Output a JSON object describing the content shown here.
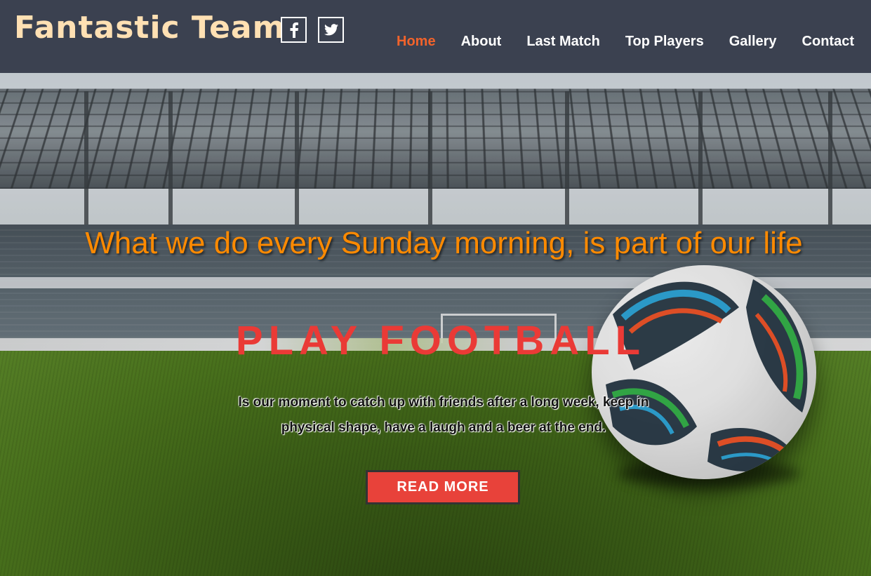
{
  "header": {
    "brand": "Fantastic Team",
    "social": [
      {
        "icon": "facebook-icon",
        "glyph": "f"
      },
      {
        "icon": "twitter-icon",
        "glyph": "twitter"
      }
    ],
    "nav": [
      {
        "label": "Home",
        "active": true
      },
      {
        "label": "About",
        "active": false
      },
      {
        "label": "Last Match",
        "active": false
      },
      {
        "label": "Top Players",
        "active": false
      },
      {
        "label": "Gallery",
        "active": false
      },
      {
        "label": "Contact",
        "active": false
      }
    ]
  },
  "hero": {
    "tagline": "What we do every Sunday morning, is part of our life",
    "headline": "PLAY FOOTBALL",
    "description_line1": "Is our moment to catch up with friends after a long week, keep in",
    "description_line2": "physical shape, have a laugh and a beer at the end.",
    "cta_label": "READ MORE"
  },
  "colors": {
    "navbar_bg": "#3b4150",
    "brand": "#ffe0b3",
    "nav_active": "#f2632b",
    "tagline": "#ff8a00",
    "headline": "#ea3a36",
    "cta_bg": "#e8423a"
  }
}
